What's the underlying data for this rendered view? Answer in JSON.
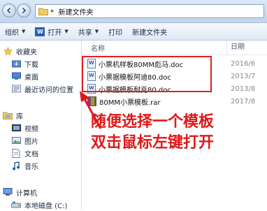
{
  "address": {
    "path": "新建文件夹"
  },
  "toolbar": {
    "organize": "组织",
    "open": "打开",
    "share": "共享",
    "print": "打印",
    "new_folder": "新建文件夹"
  },
  "sidebar": {
    "favorites": "收藏夹",
    "downloads": "下载",
    "desktop": "桌面",
    "recent": "最近访问的位置",
    "libraries": "库",
    "videos": "视频",
    "pictures": "图片",
    "documents": "文档",
    "music": "音乐",
    "computer": "计算机",
    "local_disk": "本地磁盘 (C:)"
  },
  "columns": {
    "name": "名称",
    "date": "日期"
  },
  "files": [
    {
      "name": "小票机样板80MM彪马.doc",
      "date": "2016/6"
    },
    {
      "name": "小票据模板阿迪80.doc",
      "date": "2013/7"
    },
    {
      "name": "小票据模板耐克80.doc",
      "date": "2013/8"
    },
    {
      "name": "80MM小票模板.rar",
      "date": "2017/8"
    }
  ],
  "annotation": {
    "line1": "随便选择一个模板",
    "line2": "双击鼠标左键打开",
    "color": "#e01818"
  }
}
